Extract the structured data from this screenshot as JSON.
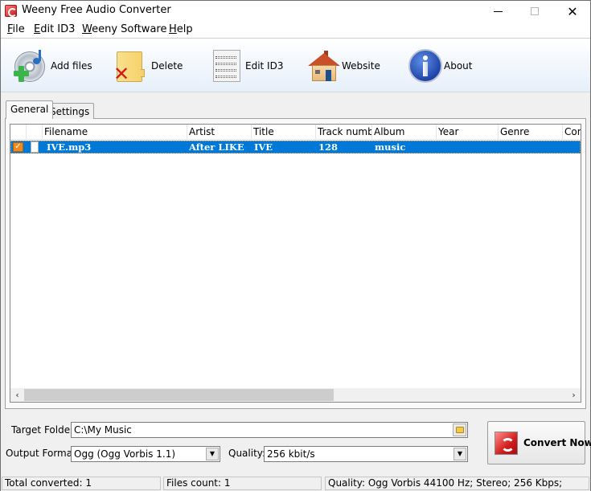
{
  "window": {
    "title": "Weeny Free Audio Converter",
    "controls": {
      "minimize": "minimize",
      "maximize": "maximize",
      "close": "close"
    }
  },
  "menu": [
    {
      "label": "File",
      "accel": "F",
      "rest": "ile"
    },
    {
      "label": "Edit ID3",
      "accel": "E",
      "rest": "dit ID3"
    },
    {
      "label": "Weeny Software",
      "accel": "W",
      "rest": "eeny Software"
    },
    {
      "label": "Help",
      "accel": "H",
      "rest": "elp"
    }
  ],
  "toolbar": {
    "add_files": {
      "label": "Add files",
      "icon": "add-music-disc-icon"
    },
    "delete": {
      "label": "Delete",
      "icon": "folder-delete-icon"
    },
    "edit_id3": {
      "label": "Edit ID3",
      "icon": "music-sheet-icon"
    },
    "website": {
      "label": "Website",
      "icon": "house-icon"
    },
    "about": {
      "label": "About",
      "icon": "info-icon"
    }
  },
  "tabs": [
    {
      "label": "General",
      "active": true
    },
    {
      "label": "Settings",
      "active": false
    }
  ],
  "file_list": {
    "columns": [
      "",
      "",
      "Filename",
      "Artist",
      "Title",
      "Track number",
      "Album",
      "Year",
      "Genre",
      "Com"
    ],
    "rows": [
      {
        "checked": true,
        "selected": true,
        "filename": "IVE.mp3",
        "artist": "After LIKE",
        "title": "IVE",
        "track_number": "128",
        "album": "music",
        "year": "",
        "genre": "",
        "comment": ""
      }
    ],
    "scroll": {
      "left_arrow": "‹",
      "right_arrow": "›"
    }
  },
  "settings": {
    "target_folder_label": "Target Folder:",
    "target_folder_value": "C:\\My Music",
    "output_format_label": "Output Format:",
    "output_format_value": "Ogg (Ogg Vorbis 1.1)",
    "quality_label": "Quality:",
    "quality_value": "256 kbit/s"
  },
  "convert_button": {
    "label": "Convert Now"
  },
  "status": {
    "total_converted": "Total converted: 1",
    "files_count": "Files count: 1",
    "quality_info": "Quality: Ogg Vorbis 44100 Hz; Stereo; 256 Kbps;"
  }
}
